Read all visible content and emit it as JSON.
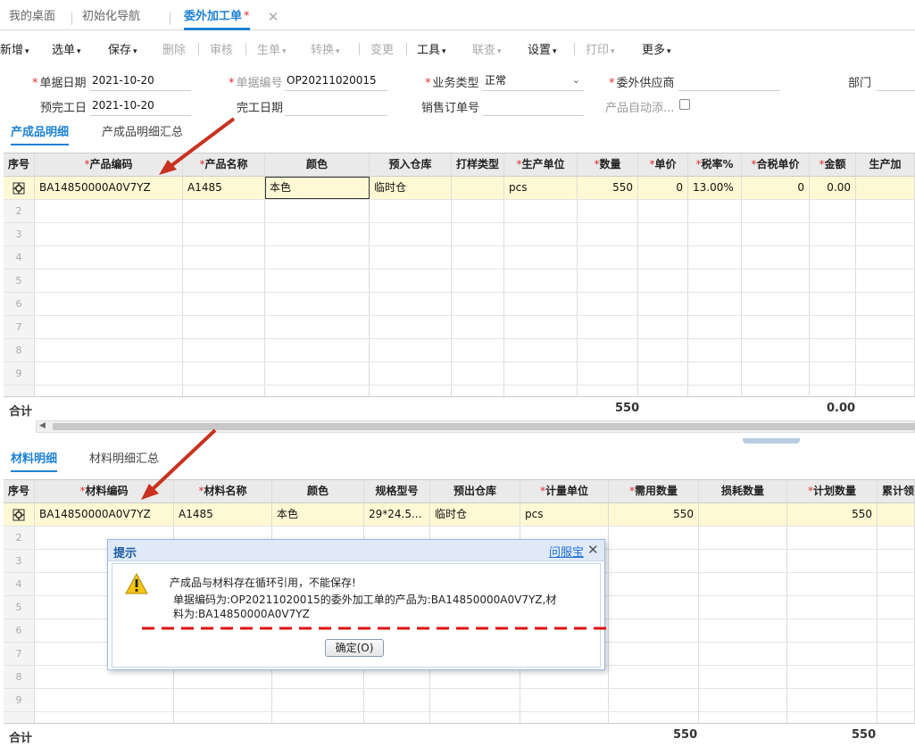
{
  "tabs": [
    {
      "label": "我的桌面"
    },
    {
      "label": "初始化导航"
    },
    {
      "label": "委外加工单",
      "modified": "*"
    }
  ],
  "toolbar": [
    {
      "label": "新增",
      "caret": "▾"
    },
    {
      "label": "选单",
      "caret": "▾"
    },
    {
      "label": "保存",
      "caret": "▾"
    },
    {
      "label": "删除"
    },
    {
      "label": "审核"
    },
    {
      "label": "生单",
      "caret": "▾"
    },
    {
      "label": "转换",
      "caret": "▾"
    },
    {
      "label": "变更"
    },
    {
      "label": "工具",
      "caret": "▾"
    },
    {
      "label": "联查",
      "caret": "▾"
    },
    {
      "label": "设置",
      "caret": "▾"
    },
    {
      "label": "打印",
      "caret": "▾"
    },
    {
      "label": "更多",
      "caret": "▾"
    }
  ],
  "form": {
    "doc_date_label": "单据日期",
    "doc_date": "2021-10-20",
    "doc_no_label": "单据编号",
    "doc_no": "OP20211020015",
    "biz_type_label": "业务类型",
    "biz_type": "正常",
    "supplier_label": "委外供应商",
    "supplier": "",
    "dept_label": "部门",
    "plan_finish_label": "预完工日",
    "plan_finish": "2021-10-20",
    "finish_label": "完工日期",
    "sales_order_label": "销售订单号",
    "auto_add_label": "产品自动添..."
  },
  "product_section": {
    "tabs": [
      "产成品明细",
      "产成品明细汇总"
    ],
    "columns": [
      "序号",
      "产品编码",
      "产品名称",
      "颜色",
      "预入仓库",
      "打样类型",
      "生产单位",
      "数量",
      "单价",
      "税率%",
      "合税单价",
      "金额",
      "生产加"
    ],
    "required": [
      "产品编码",
      "产品名称",
      "生产单位",
      "数量",
      "单价",
      "税率%",
      "合税单价",
      "金额"
    ],
    "rows": [
      [
        "",
        "BA14850000A0V7YZ",
        "A1485",
        "本色",
        "临时仓",
        "",
        "pcs",
        "550",
        "0",
        "13.00%",
        "0",
        "0.00",
        ""
      ]
    ],
    "empty_rows": [
      "2",
      "3",
      "4",
      "5",
      "6",
      "7",
      "8",
      "9"
    ],
    "total_label": "合计",
    "total_qty": "550",
    "total_amount": "0.00"
  },
  "material_section": {
    "tabs": [
      "材料明细",
      "材料明细汇总"
    ],
    "columns": [
      "序号",
      "材料编码",
      "材料名称",
      "颜色",
      "规格型号",
      "预出仓库",
      "计量单位",
      "需用数量",
      "损耗数量",
      "计划数量",
      "累计领"
    ],
    "required": [
      "材料编码",
      "材料名称",
      "计量单位",
      "需用数量",
      "计划数量"
    ],
    "rows": [
      [
        "",
        "BA14850000A0V7YZ",
        "A1485",
        "本色",
        "29*24.5...",
        "临时仓",
        "pcs",
        "550",
        "",
        "550",
        ""
      ]
    ],
    "empty_rows": [
      "2",
      "3",
      "4",
      "5",
      "6",
      "7",
      "8",
      "9"
    ],
    "total_label": "合计",
    "total_req": "550",
    "total_plan": "550"
  },
  "dialog": {
    "title": "提示",
    "help_link": "问服宝",
    "message": "产成品与材料存在循环引用，不能保存!",
    "detail": "单据编码为:OP20211020015的委外加工单的产品为:BA14850000A0V7YZ,材料为:BA14850000A0V7YZ",
    "ok_button": "确定(O)"
  },
  "colors": {
    "accent": "#1e82d2",
    "required": "#e03030",
    "highlight_row": "#fff8d4",
    "annotation": "#e01010"
  }
}
